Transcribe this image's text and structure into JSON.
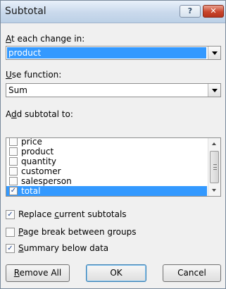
{
  "dialog": {
    "title": "Subtotal",
    "help_label": "?",
    "close_label": "✕"
  },
  "change_in": {
    "label_ul": "A",
    "label_rest": "t each change in:",
    "value": "product"
  },
  "use_function": {
    "label_ul": "U",
    "label_rest": "se function:",
    "value": "Sum"
  },
  "add_subtotal": {
    "label_pre": "A",
    "label_ul": "d",
    "label_rest": "d subtotal to:",
    "items": [
      {
        "label": "price",
        "checked": false
      },
      {
        "label": "product",
        "checked": false
      },
      {
        "label": "quantity",
        "checked": false
      },
      {
        "label": "customer",
        "checked": false
      },
      {
        "label": "salesperson",
        "checked": false
      },
      {
        "label": "total",
        "checked": true
      }
    ],
    "selected_index": 5
  },
  "options": {
    "replace": {
      "pre": "Replace ",
      "ul": "c",
      "rest": "urrent subtotals",
      "checked": true
    },
    "page_break": {
      "pre": "",
      "ul": "P",
      "rest": "age break between groups",
      "checked": false
    },
    "summary": {
      "pre": "",
      "ul": "S",
      "rest": "ummary below data",
      "checked": true
    }
  },
  "buttons": {
    "remove_all": {
      "ul": "R",
      "rest": "emove All"
    },
    "ok": "OK",
    "cancel": "Cancel"
  },
  "check_glyph": "✓",
  "colors": {
    "selection": "#3399ff",
    "close": "#c9452b",
    "title_bar": "#c9d9ec"
  }
}
